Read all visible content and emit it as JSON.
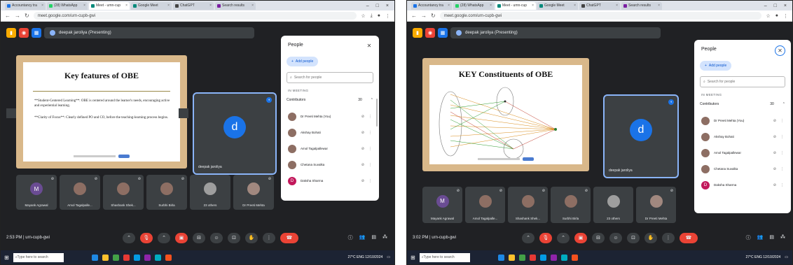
{
  "left": {
    "tabs": [
      "Accountancy tra",
      "(28) WhatsApp",
      "Meet - umn-cup",
      "Google Meet",
      "ChatGPT",
      "Search results"
    ],
    "url": "meet.google.com/urn-cupb-gwi",
    "presenting": "deepak jaroliya (Presenting)",
    "slide": {
      "title": "Key features of OBE",
      "bullets": [
        "**Student-Centered Learning**: OBE is centered around the learner's needs, encouraging active and experiential learning.",
        "**Clarity of Focus**: Clearly defined PO and CO, before the teaching-learning process begins."
      ]
    },
    "self": {
      "initial": "d",
      "name": "deepak jaroliya"
    },
    "tiles": [
      {
        "initial": "M",
        "name": "Mayank Agrawal"
      },
      {
        "initial": "",
        "name": "Amol Tagalpalle..."
      },
      {
        "initial": "",
        "name": "Shashank Shek..."
      },
      {
        "initial": "",
        "name": "Surbhi Birla"
      },
      {
        "initial": "",
        "name": "23 others"
      },
      {
        "initial": "",
        "name": "Dr Preeti Mehta"
      }
    ],
    "people": {
      "title": "People",
      "add": "Add people",
      "search_placeholder": "Search for people",
      "in_meeting": "IN MEETING",
      "contributors": "Contributors",
      "count": "30",
      "list": [
        "Dr Preeti Mehta (You)",
        "Akshay Bohati",
        "Amol Tagalpallewar",
        "Chetana Suvalka",
        "Daksha Sharma"
      ]
    },
    "time": "2:53 PM  |  urn-cupb-gwi",
    "taskbar_search": "Type here to search",
    "tray": "27°C  ENG 12/10/2024"
  },
  "right": {
    "tabs": [
      "Accountancy tra",
      "(28) WhatsApp",
      "Meet - umn-cup",
      "Google Meet",
      "ChatGPT",
      "Search results"
    ],
    "url": "meet.google.com/urn-cupb-gwi",
    "presenting": "deepak jaroliya (Presenting)",
    "slide": {
      "title": "KEY Constituents of OBE"
    },
    "self": {
      "initial": "d",
      "name": "deepak jaroliya"
    },
    "tiles": [
      {
        "initial": "M",
        "name": "Mayank Agrawal"
      },
      {
        "initial": "",
        "name": "Amol Tagalpalle..."
      },
      {
        "initial": "",
        "name": "Shashank Shek..."
      },
      {
        "initial": "",
        "name": "Surbhi Birla"
      },
      {
        "initial": "",
        "name": "23 others"
      },
      {
        "initial": "",
        "name": "Dr Preeti Mehta"
      }
    ],
    "people": {
      "title": "People",
      "add": "Add people",
      "search_placeholder": "Search for people",
      "in_meeting": "IN MEETING",
      "contributors": "Contributors",
      "count": "30",
      "list": [
        "Dr Preeti Mehta (You)",
        "Akshay Bohati",
        "Amol Tagalpallewar",
        "Chetana Suvalka",
        "Daksha Sharma"
      ]
    },
    "time": "3:02 PM  |  urn-cupb-gwi",
    "taskbar_search": "Type here to search",
    "tray": "27°C  ENG 12/10/2024"
  },
  "colors": {
    "meet_bg": "#202124",
    "tile_bg": "#3c4043",
    "accent": "#1a73e8",
    "end_call": "#ea4335"
  }
}
